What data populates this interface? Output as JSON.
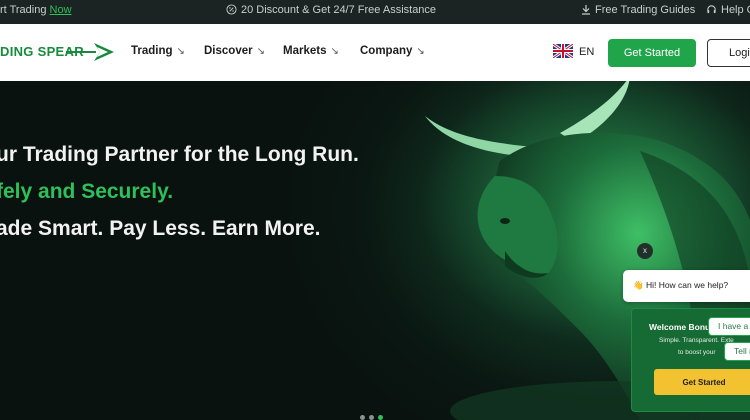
{
  "topbar": {
    "left_prefix": "rt Trading ",
    "left_link": "Now",
    "promo": "20 Discount & Get 24/7 Free Assistance",
    "guides": "Free Trading Guides",
    "help": "Help C"
  },
  "nav": {
    "logo_text": "DING SPEAR",
    "menu": [
      {
        "label": "Trading"
      },
      {
        "label": "Discover"
      },
      {
        "label": "Markets"
      },
      {
        "label": "Company"
      }
    ],
    "language": "EN",
    "get_started": "Get Started",
    "login": "Logi"
  },
  "hero": {
    "line1": "ur Trading Partner for the Long Run.",
    "line2": "fely and Securely.",
    "line3": "ade Smart. Pay Less. Earn More.",
    "slides_total": 3,
    "slide_active": 3
  },
  "chat": {
    "close": "x",
    "greeting": "👋 Hi! How can we help?",
    "bonus_title": "Welcome Bonu",
    "bonus_desc1": "Simple. Transparent. Exte",
    "bonus_desc2": "to boost your",
    "bonus_button": "Get Started",
    "quick_reply1": "I have a q",
    "quick_reply2": "Tell m"
  },
  "colors": {
    "brand_green": "#21a54a",
    "accent_green": "#2fbf5b",
    "topbar_bg": "#1b2422",
    "bonus_button": "#f2c230"
  },
  "icons": {
    "promo": "percent-badge-icon",
    "guides": "download-icon",
    "help": "headset-icon",
    "language": "uk-flag-icon"
  }
}
